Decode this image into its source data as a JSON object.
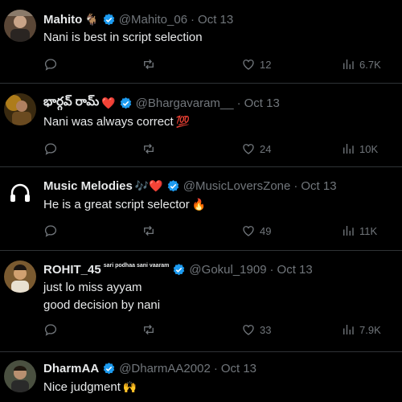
{
  "tweets": [
    {
      "name": "Mahito",
      "name_emoji": "🐐",
      "handle": "@Mahito_06",
      "date": "Oct 13",
      "lines": [
        "Nani is best in script selection"
      ],
      "likes": "12",
      "views": "6.7K",
      "avatar": "mahito-avatar"
    },
    {
      "name": "భార్గవ్ రామ్",
      "name_emoji": "❤️",
      "handle": "@Bhargavaram__",
      "date": "Oct 13",
      "lines": [
        "Nani was always correct"
      ],
      "body_emoji": "💯",
      "likes": "24",
      "views": "10K",
      "avatar": "bhargav-avatar"
    },
    {
      "name": "Music Melodies",
      "name_emoji": "🎶❤️",
      "handle": "@MusicLoversZone",
      "date": "Oct 13",
      "lines": [
        "He is a great script selector"
      ],
      "body_emoji": "🔥",
      "likes": "49",
      "views": "11K",
      "avatar": "headphones-avatar"
    },
    {
      "name": "ROHIT_45",
      "name_suffix": "sari podhaa sani vaaram",
      "handle": "@Gokul_1909",
      "date": "Oct 13",
      "lines": [
        "just lo miss ayyam",
        "good decision by nani"
      ],
      "likes": "33",
      "views": "7.9K",
      "avatar": "rohit-avatar"
    },
    {
      "name": "DharmAA",
      "handle": "@DharmAA2002",
      "date": "Oct 13",
      "lines": [
        "Nice judgment"
      ],
      "body_emoji": "🙌",
      "avatar": "dharmaa-avatar"
    }
  ],
  "separator": "·",
  "colors": {
    "background": "#000000",
    "text": "#e7e9ea",
    "muted": "#71767b",
    "verified": "#1d9bf0",
    "divider": "#2f3336"
  }
}
